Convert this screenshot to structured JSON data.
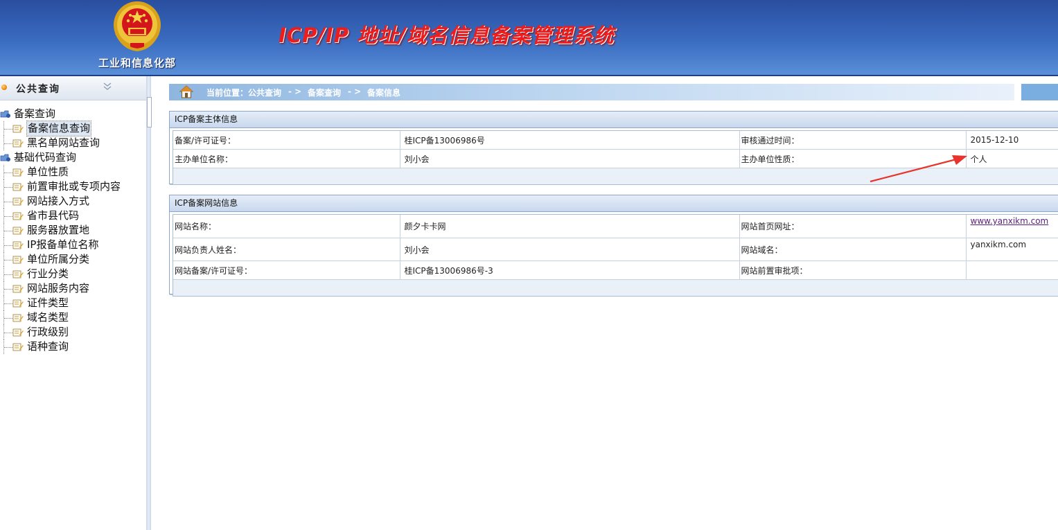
{
  "header": {
    "ministry": "工业和信息化部",
    "system_title": "ICP/IP 地址/域名信息备案管理系统",
    "emblem_icon": "national-emblem-icon"
  },
  "sidebar": {
    "section_title": "公共查询",
    "tree": [
      {
        "type": "group",
        "label": "备案查询"
      },
      {
        "type": "leaf",
        "label": "备案信息查询",
        "selected": true
      },
      {
        "type": "leaf",
        "label": "黑名单网站查询"
      },
      {
        "type": "group",
        "label": "基础代码查询"
      },
      {
        "type": "leaf",
        "label": "单位性质"
      },
      {
        "type": "leaf",
        "label": "前置审批或专项内容"
      },
      {
        "type": "leaf",
        "label": "网站接入方式"
      },
      {
        "type": "leaf",
        "label": "省市县代码"
      },
      {
        "type": "leaf",
        "label": "服务器放置地"
      },
      {
        "type": "leaf",
        "label": "IP报备单位名称"
      },
      {
        "type": "leaf",
        "label": "单位所属分类"
      },
      {
        "type": "leaf",
        "label": "行业分类"
      },
      {
        "type": "leaf",
        "label": "网站服务内容"
      },
      {
        "type": "leaf",
        "label": "证件类型"
      },
      {
        "type": "leaf",
        "label": "域名类型"
      },
      {
        "type": "leaf",
        "label": "行政级别"
      },
      {
        "type": "leaf",
        "label": "语种查询"
      }
    ]
  },
  "breadcrumb": {
    "current": "当前位置：公共查询",
    "sep1": "- >",
    "level2": "备案查询",
    "sep2": "- >",
    "level3": "备案信息"
  },
  "entity_panel": {
    "title": "ICP备案主体信息",
    "rows": [
      {
        "label1": "备案/许可证号：",
        "value1": "桂ICP备13006986号",
        "label2": "审核通过时间：",
        "value2": "2015-12-10"
      },
      {
        "label1": "主办单位名称：",
        "value1": "刘小会",
        "label2": "主办单位性质：",
        "value2": "个人"
      }
    ]
  },
  "website_panel": {
    "title": "ICP备案网站信息",
    "rows": [
      {
        "label1": "网站名称：",
        "value1": "颜夕卡卡网",
        "label2": "网站首页网址：",
        "value2": "www.yanxikm.com"
      },
      {
        "label1": "网站负责人姓名：",
        "value1": "刘小会",
        "label2": "网站域名：",
        "value2": "yanxikm.com"
      },
      {
        "label1": "网站备案/许可证号：",
        "value1": "桂ICP备13006986号-3",
        "label2": "网站前置审批项：",
        "value2": ""
      }
    ]
  },
  "colors": {
    "header_blue": "#2a4ea0",
    "title_red": "#ee1c1c",
    "arrow_red": "#e8342c",
    "link_purple": "#5a1e7a"
  }
}
